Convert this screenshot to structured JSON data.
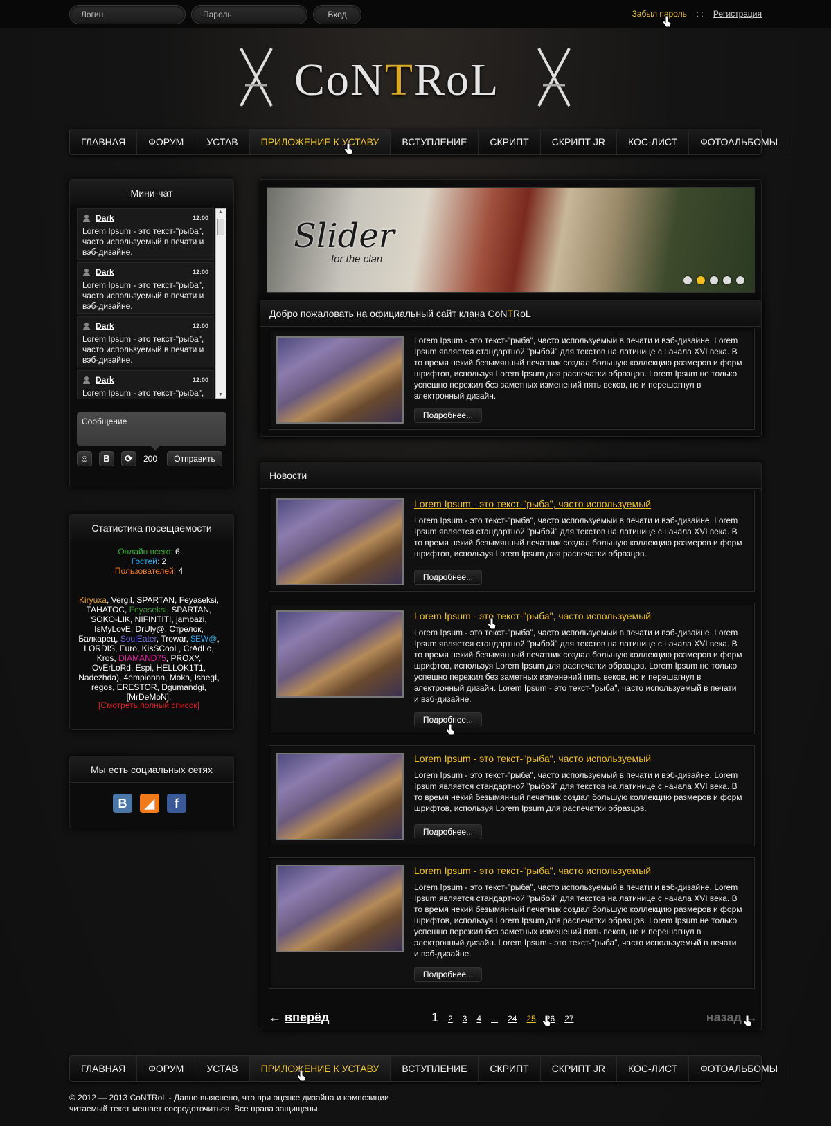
{
  "top": {
    "login_placeholder": "Логин",
    "password_placeholder": "Пароль",
    "enter_label": "Вход",
    "forgot_label": "Забыл пароль",
    "separator": ": :",
    "register_label": "Регистрация"
  },
  "logo": {
    "part1": "CoN",
    "gold": "T",
    "part2": "RoL"
  },
  "nav": {
    "items": [
      "ГЛАВНАЯ",
      "ФОРУМ",
      "УСТАВ",
      "ПРИЛОЖЕНИЕ К УСТАВУ",
      "ВСТУПЛЕНИЕ",
      "СКРИПТ",
      "СКРИПТ JR",
      "КОС-ЛИСТ",
      "ФОТОАЛЬБОМЫ"
    ],
    "active_index": 3
  },
  "minichat": {
    "title": "Мини-чат",
    "messages": [
      {
        "user": "Dark",
        "time": "12:00",
        "text": "Lorem Ipsum - это текст-\"рыба\", часто используемый в печати и вэб-дизайне."
      },
      {
        "user": "Dark",
        "time": "12:00",
        "text": "Lorem Ipsum - это текст-\"рыба\", часто используемый в печати и вэб-дизайне."
      },
      {
        "user": "Dark",
        "time": "12:00",
        "text": "Lorem Ipsum - это текст-\"рыба\", часто используемый в печати и вэб-дизайне."
      },
      {
        "user": "Dark",
        "time": "12:00",
        "text": "Lorem Ipsum - это текст-\"рыба\", часто используемый в печати и вэб-дизайне."
      }
    ],
    "message_placeholder": "Сообщение",
    "counter": "200",
    "send_label": "Отправить",
    "bold_label": "B"
  },
  "stats": {
    "title": "Статистика посещаемости",
    "online_label": "Онлайн всего:",
    "online_value": "6",
    "guests_label": "Гостей:",
    "guests_value": "2",
    "users_label": "Пользователей:",
    "users_value": "4",
    "users_list": [
      {
        "name": "Kiryuxa",
        "color": "#f0a020"
      },
      {
        "name": "Vergil"
      },
      {
        "name": "SPARTAN"
      },
      {
        "name": "Feyaseksi"
      },
      {
        "name": "TAHATOC"
      },
      {
        "name": "Feyaseksi",
        "color": "#30a030"
      },
      {
        "name": "SPARTAN"
      },
      {
        "name": "SOKO-LIK"
      },
      {
        "name": "NIFINTITI"
      },
      {
        "name": "jambazi"
      },
      {
        "name": "IsMyLovE"
      },
      {
        "name": "DrUly@"
      },
      {
        "name": "Стрелок"
      },
      {
        "name": "Балкарец"
      },
      {
        "name": "SoulEater",
        "color": "#7070e0"
      },
      {
        "name": "Trowar"
      },
      {
        "name": "$EW@",
        "color": "#30a0e0"
      },
      {
        "name": "LORDIS"
      },
      {
        "name": "Euro"
      },
      {
        "name": "KisSCooL"
      },
      {
        "name": "CrAdLo"
      },
      {
        "name": "Kros"
      },
      {
        "name": "DIAMAND75",
        "color": "#e020a0"
      },
      {
        "name": "PROXY"
      },
      {
        "name": "OvErLoRd"
      },
      {
        "name": "Espi"
      },
      {
        "name": "HELLOK1T1"
      },
      {
        "name": "Nadezhda)"
      },
      {
        "name": "4empionnn"
      },
      {
        "name": "Moka"
      },
      {
        "name": "IshegI"
      },
      {
        "name": "regos"
      },
      {
        "name": "ERESTOR"
      },
      {
        "name": "Dgumandgi"
      },
      {
        "name": "[MrDeMoN]"
      }
    ],
    "full_list_label": "[Смотреть полный список]"
  },
  "social": {
    "title": "Мы есть социальных сетях",
    "items": [
      {
        "name": "vkontakte",
        "glyph": "B",
        "color": "#4a76a8"
      },
      {
        "name": "rss",
        "glyph": "◢",
        "color": "#f07b1d"
      },
      {
        "name": "facebook",
        "glyph": "f",
        "color": "#3b5998"
      }
    ]
  },
  "slider": {
    "title": "Slider",
    "subtitle": "for the clan",
    "dots": 5,
    "active_dot": 1
  },
  "welcome": {
    "title_pre": "Добро пожаловать на официальный сайт клана Co",
    "title_n": "N",
    "title_t": "T",
    "title_post": "RoL",
    "text": "Lorem Ipsum - это текст-\"рыба\", часто используемый в печати и вэб-дизайне. Lorem Ipsum является стандартной \"рыбой\" для текстов на латинице с начала XVI века. В то время некий безымянный печатник создал большую коллекцию размеров и форм шрифтов, используя Lorem Ipsum для распечатки образцов. Lorem Ipsum не только успешно пережил без заметных изменений пять веков, но и перешагнул в электронный дизайн.",
    "more_label": "Подробнее..."
  },
  "news": {
    "title": "Новости",
    "items": [
      {
        "title": "Lorem Ipsum - это текст-\"рыба\", часто используемый",
        "underlined": true,
        "text": "Lorem Ipsum - это текст-\"рыба\", часто используемый в печати и вэб-дизайне. Lorem Ipsum является стандартной \"рыбой\" для текстов на латинице с начала XVI века. В то время некий безымянный печатник создал большую коллекцию размеров и форм шрифтов, используя Lorem Ipsum для распечатки образцов.",
        "more_label": "Подробнее..."
      },
      {
        "title": "Lorem Ipsum - это текст-\"рыба\", часто используемый",
        "underlined": false,
        "text": "Lorem Ipsum - это текст-\"рыба\", часто используемый в печати и вэб-дизайне. Lorem Ipsum является стандартной \"рыбой\" для текстов на латинице с начала XVI века. В то время некий безымянный печатник создал большую коллекцию размеров и форм шрифтов, используя Lorem Ipsum для распечатки образцов. Lorem Ipsum не только успешно пережил без заметных изменений пять веков, но и перешагнул в электронный дизайн. Lorem Ipsum - это текст-\"рыба\", часто используемый в печати и вэб-дизайне.",
        "more_label": "Подробнее..."
      },
      {
        "title": "Lorem Ipsum - это текст-\"рыба\", часто используемый",
        "underlined": true,
        "text": "Lorem Ipsum - это текст-\"рыба\", часто используемый в печати и вэб-дизайне. Lorem Ipsum является стандартной \"рыбой\" для текстов на латинице с начала XVI века. В то время некий безымянный печатник создал большую коллекцию размеров и форм шрифтов, используя Lorem Ipsum для распечатки образцов.",
        "more_label": "Подробнее..."
      },
      {
        "title": "Lorem Ipsum - это текст-\"рыба\", часто используемый",
        "underlined": true,
        "text": "Lorem Ipsum - это текст-\"рыба\", часто используемый в печати и вэб-дизайне. Lorem Ipsum является стандартной \"рыбой\" для текстов на латинице с начала XVI века. В то время некий безымянный печатник создал большую коллекцию размеров и форм шрифтов, используя Lorem Ipsum для распечатки образцов. Lorem Ipsum не только успешно пережил без заметных изменений пять веков, но и перешагнул в электронный дизайн. Lorem Ipsum - это текст-\"рыба\", часто используемый в печати и вэб-дизайне.",
        "more_label": "Подробнее..."
      }
    ]
  },
  "pager": {
    "prev_arrow": "←",
    "prev_label": "вперёд",
    "pages": [
      "1",
      "2",
      "3",
      "4",
      "...",
      "24",
      "25",
      "26",
      "27"
    ],
    "current": "1",
    "highlight": "25",
    "next_label": "назад",
    "next_arrow": "→"
  },
  "footer": {
    "text": "© 2012 — 2013 CoNTRoL - Давно выяснено, что при оценке дизайна и композиции читаемый текст мешает сосредоточиться. Все права защищены."
  }
}
